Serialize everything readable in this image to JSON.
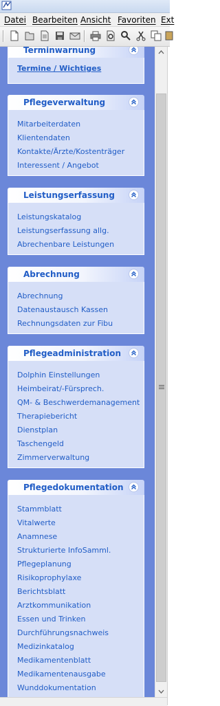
{
  "menu": [
    {
      "label": "Datei"
    },
    {
      "label": "Bearbeiten"
    },
    {
      "label": "Ansicht"
    },
    {
      "label": "Favoriten"
    },
    {
      "label": "Ext"
    }
  ],
  "toolbar": {
    "icons": [
      "new-document-icon",
      "open-document-icon",
      "document-icon",
      "save-icon",
      "mail-icon",
      "print-icon",
      "print-preview-icon",
      "find-icon",
      "cut-icon",
      "copy-icon"
    ]
  },
  "groups": [
    {
      "title": "Terminwarnung",
      "tasks": [
        "Termine / Wichtiges"
      ]
    },
    {
      "title": "Pflegeverwaltung",
      "tasks": [
        "Mitarbeiterdaten",
        "Klientendaten",
        "Kontakte/Ärzte/Kostenträger",
        "Interessent / Angebot"
      ]
    },
    {
      "title": "Leistungserfassung",
      "tasks": [
        "Leistungskatalog",
        "Leistungserfassung allg.",
        "Abrechenbare Leistungen"
      ]
    },
    {
      "title": "Abrechnung",
      "tasks": [
        "Abrechnung",
        "Datenaustausch Kassen",
        "Rechnungsdaten zur Fibu"
      ]
    },
    {
      "title": "Pflegeadministration",
      "tasks": [
        "Dolphin Einstellungen",
        "Heimbeirat/-Fürsprech.",
        "QM- & Beschwerdemanagement",
        "Therapiebericht",
        "Dienstplan",
        "Taschengeld",
        "Zimmerverwaltung"
      ]
    },
    {
      "title": "Pflegedokumentation",
      "tasks": [
        "Stammblatt",
        "Vitalwerte",
        "Anamnese",
        "Strukturierte InfoSamml.",
        "Pflegeplanung",
        "Risikoprophylaxe",
        "Berichtsblatt",
        "Arztkommunikation",
        "Essen und Trinken",
        "Durchführungsnachweis",
        "Medizinkatalog",
        "Medikamentenblatt",
        "Medikamentenausgabe",
        "Wunddokumentation"
      ]
    }
  ],
  "colors": {
    "pane_background": "#6b87d9",
    "group_body": "#d6dff7",
    "link": "#215dc6"
  }
}
